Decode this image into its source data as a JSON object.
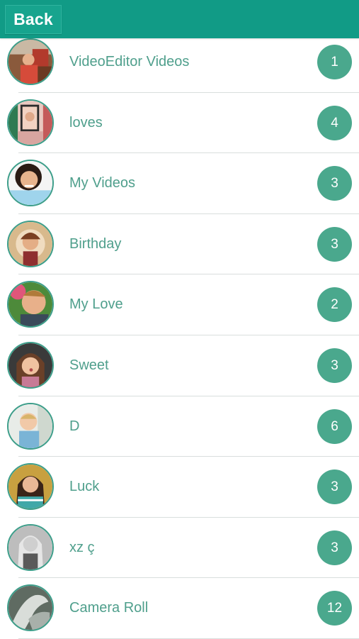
{
  "header": {
    "back_label": "Back",
    "bar_color": "#119b86"
  },
  "albums": [
    {
      "name": "VideoEditor Videos",
      "count": "1",
      "thumb": "album-thumbnail"
    },
    {
      "name": "loves",
      "count": "4",
      "thumb": "album-thumbnail"
    },
    {
      "name": "My Videos",
      "count": "3",
      "thumb": "album-thumbnail"
    },
    {
      "name": "Birthday",
      "count": "3",
      "thumb": "album-thumbnail"
    },
    {
      "name": "My Love",
      "count": "2",
      "thumb": "album-thumbnail"
    },
    {
      "name": "Sweet",
      "count": "3",
      "thumb": "album-thumbnail"
    },
    {
      "name": "D",
      "count": "6",
      "thumb": "album-thumbnail"
    },
    {
      "name": "Luck",
      "count": "3",
      "thumb": "album-thumbnail"
    },
    {
      "name": "xz ç",
      "count": "3",
      "thumb": "album-thumbnail"
    },
    {
      "name": "Camera Roll",
      "count": "12",
      "thumb": "album-thumbnail"
    }
  ],
  "colors": {
    "label_text": "#4f9f8c",
    "count_badge": "#4aa88d",
    "avatar_ring": "#3d9e8a",
    "separator": "#d9dedd"
  }
}
